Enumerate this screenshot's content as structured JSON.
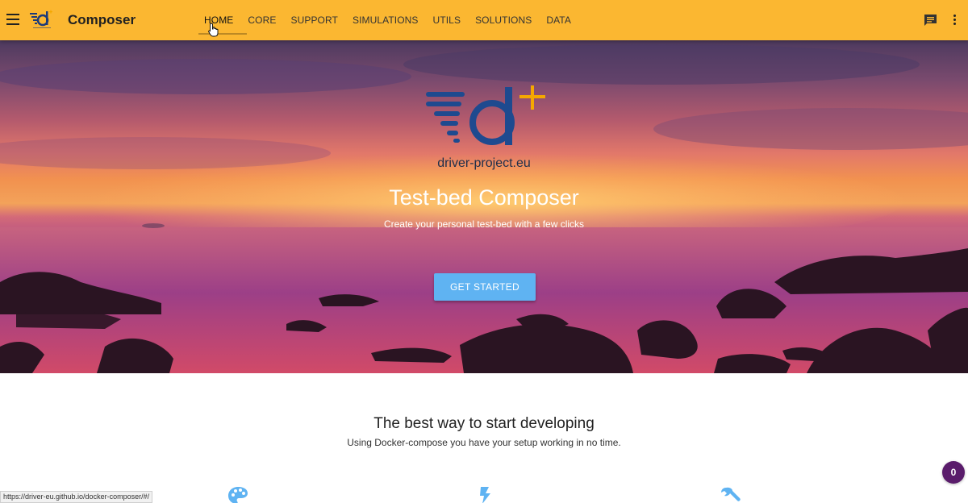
{
  "appbar": {
    "title": "Composer",
    "nav": [
      "HOME",
      "CORE",
      "SUPPORT",
      "SIMULATIONS",
      "UTILS",
      "SOLUTIONS",
      "DATA"
    ],
    "active": "HOME",
    "icons": [
      "menu-icon",
      "logo",
      "chat-icon",
      "more-vert-icon"
    ],
    "color": "#fbb731"
  },
  "hero": {
    "domain": "driver-project.eu",
    "title": "Test-bed Composer",
    "subtitle": "Create your personal test-bed with a few clicks",
    "cta_label": "GET STARTED",
    "cta_color": "#5fb3f2"
  },
  "section": {
    "title": "The best way to start developing",
    "subtitle": "Using Docker-compose you have your setup working in no time.",
    "feature_icons": [
      "palette-icon",
      "flash-icon",
      "wrench-icon"
    ],
    "icon_color": "#5fb3f2"
  },
  "status_bar": {
    "url": "https://driver-eu.github.io/docker-composer/#/"
  },
  "badge": {
    "count": "0",
    "color": "#5a1c6b"
  }
}
